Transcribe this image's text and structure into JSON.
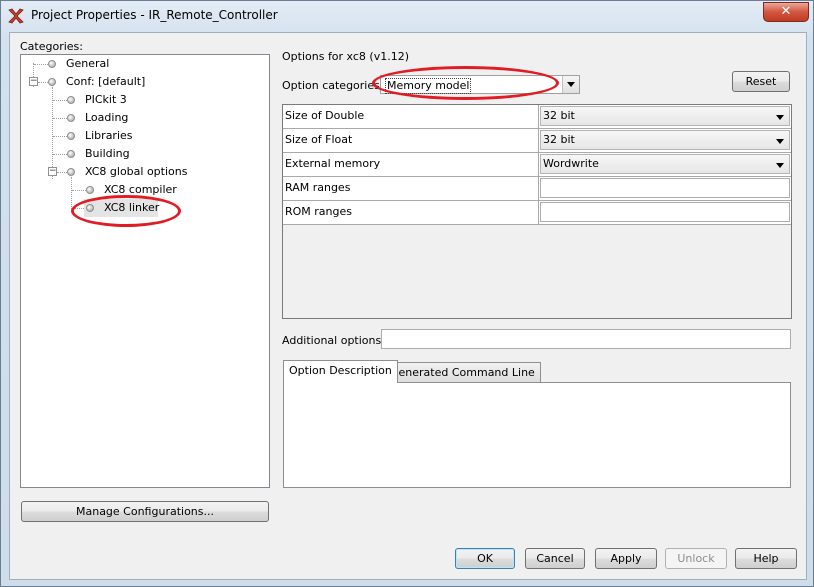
{
  "window": {
    "title": "Project Properties - IR_Remote_Controller",
    "close_glyph": "✕"
  },
  "categories": {
    "label": "Categories:",
    "tree": [
      {
        "label": "General"
      },
      {
        "label": "Conf: [default]"
      },
      {
        "label": "PICkit 3"
      },
      {
        "label": "Loading"
      },
      {
        "label": "Libraries"
      },
      {
        "label": "Building"
      },
      {
        "label": "XC8 global options"
      },
      {
        "label": "XC8 compiler"
      },
      {
        "label": "XC8 linker",
        "selected": true
      }
    ],
    "manage_button": "Manage Configurations..."
  },
  "options": {
    "header": "Options for xc8 (v1.12)",
    "category_label": "Option categories:",
    "category_value": "Memory model",
    "reset_button": "Reset",
    "rows": [
      {
        "name": "Size of Double",
        "value": "32 bit",
        "type": "dropdown"
      },
      {
        "name": "Size of Float",
        "value": "32 bit",
        "type": "dropdown"
      },
      {
        "name": "External memory",
        "value": "Wordwrite",
        "type": "dropdown"
      },
      {
        "name": "RAM ranges",
        "value": "",
        "type": "text"
      },
      {
        "name": "ROM ranges",
        "value": "",
        "type": "text"
      }
    ],
    "additional_label": "Additional options:",
    "additional_value": ""
  },
  "tabs": [
    {
      "label": "Option Description",
      "active": true
    },
    {
      "label": "Generated Command Line",
      "active": false
    }
  ],
  "footer": {
    "ok": "OK",
    "cancel": "Cancel",
    "apply": "Apply",
    "unlock": "Unlock",
    "help": "Help"
  },
  "annotation": {
    "color": "#e11c24"
  }
}
